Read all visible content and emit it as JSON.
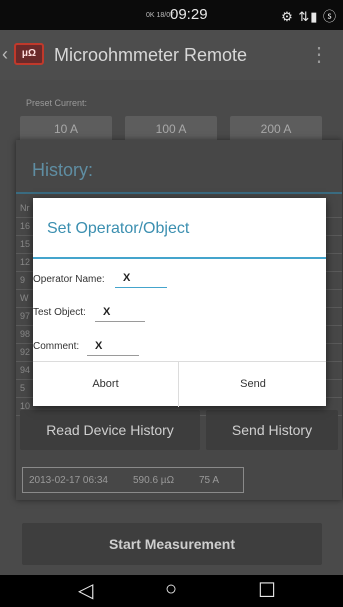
{
  "status_bar": {
    "network_text": "0K 18/07",
    "time": "09:29",
    "icons_glyph": "⚙ ⇅▮ ⓢ"
  },
  "app_bar": {
    "logo_text": "μΩ",
    "title": "Microohmmeter Remote"
  },
  "preset": {
    "label": "Preset Current:",
    "buttons": [
      "10 A",
      "100 A",
      "200 A"
    ]
  },
  "history": {
    "title": "History:",
    "rows": [
      "Nr",
      "16",
      "15",
      "12",
      "9",
      "W",
      "97",
      "98",
      "92",
      "94",
      "5",
      "10"
    ],
    "read_device_history": "Read Device History",
    "send_history": "Send History",
    "bottom_row": {
      "date": "2013-02-17 06:34",
      "value": "590.6 µΩ",
      "current": "75 A"
    }
  },
  "start_measurement": "Start Measurement",
  "dialog": {
    "title": "Set Operator/Object",
    "fields": [
      {
        "label": "Operator Name:",
        "value": "X"
      },
      {
        "label": "Test Object:",
        "value": "X"
      },
      {
        "label": "Comment:",
        "value": "X"
      }
    ],
    "abort_label": "Abort",
    "send_label": "Send"
  },
  "nav": {
    "back_glyph": "◁",
    "home_glyph": "○",
    "recents_glyph": "☐"
  }
}
